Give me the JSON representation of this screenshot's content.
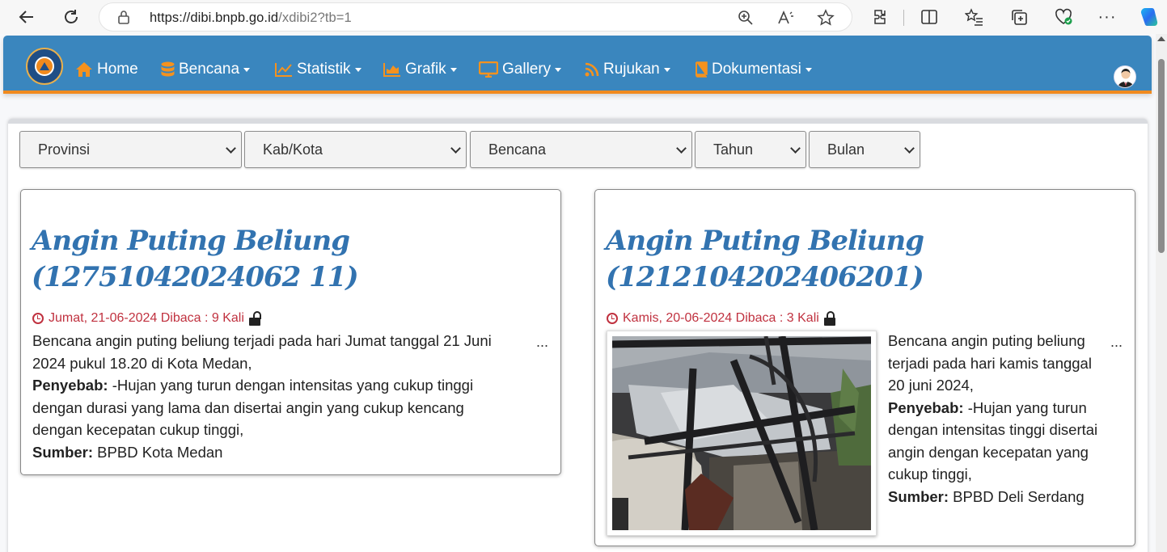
{
  "browser": {
    "url_host": "https://dibi.bnpb.go.id",
    "url_path": "/xdibi2?tb=1"
  },
  "navbar": {
    "items": [
      {
        "label": "Home",
        "icon": "home-icon",
        "dropdown": false
      },
      {
        "label": "Bencana",
        "icon": "database-icon",
        "dropdown": true
      },
      {
        "label": "Statistik",
        "icon": "line-chart-icon",
        "dropdown": true
      },
      {
        "label": "Grafik",
        "icon": "area-chart-icon",
        "dropdown": true
      },
      {
        "label": "Gallery",
        "icon": "desktop-icon",
        "dropdown": true
      },
      {
        "label": "Rujukan",
        "icon": "rss-icon",
        "dropdown": true
      },
      {
        "label": "Dokumentasi",
        "icon": "book-icon",
        "dropdown": true
      }
    ],
    "accent": "#f5921e",
    "bar_color": "#3a86be"
  },
  "filters": {
    "provinsi": "Provinsi",
    "kabkota": "Kab/Kota",
    "bencana": "Bencana",
    "tahun": "Tahun",
    "bulan": "Bulan"
  },
  "cards": [
    {
      "title_line1": "Angin Puting Beliung",
      "title_line2": "(12751042024062 11)",
      "meta": "Jumat, 21-06-2024 Dibaca : 9 Kali",
      "desc_line1": "Bencana angin puting beliung terjadi pada hari Jumat tanggal 21 Juni",
      "desc_line2": "2024 pukul 18.20 di Kota Medan,",
      "penyebab_label": "Penyebab:",
      "penyebab_line1": " -Hujan yang turun dengan intensitas yang cukup tinggi",
      "penyebab_line2": "dengan durasi yang lama dan disertai angin yang cukup kencang",
      "penyebab_line3": "dengan kecepatan cukup tinggi,",
      "sumber_label": "Sumber:",
      "sumber": " BPBD Kota Medan",
      "more": "..."
    },
    {
      "title_line1": "Angin Puting Beliung",
      "title_line2": "(1212104202406201)",
      "meta": "Kamis, 20-06-2024 Dibaca : 3 Kali",
      "desc_line1": "Bencana angin puting beliung",
      "desc_line2": "terjadi pada hari kamis tanggal",
      "desc_line3": "20 juni 2024,",
      "penyebab_label": "Penyebab:",
      "penyebab_line1": " -Hujan yang turun",
      "penyebab_line2": "dengan intensitas tinggi disertai",
      "penyebab_line3": "angin dengan kecepatan yang",
      "penyebab_line4": "cukup tinggi,",
      "sumber_label": "Sumber:",
      "sumber": " BPBD Deli Serdang",
      "more": "..."
    }
  ]
}
